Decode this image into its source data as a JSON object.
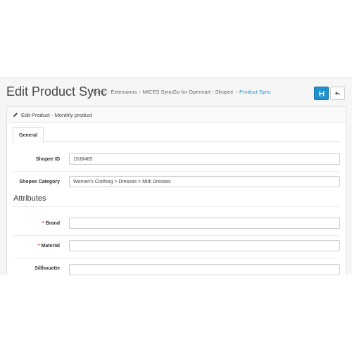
{
  "header": {
    "title": "Edit Product Sync",
    "breadcrumbs": [
      "Home",
      "Extensions",
      "MICES SyncGo for Opencart - Shopee",
      "Product Sync"
    ],
    "separator": "›"
  },
  "panel": {
    "heading": "Edit Product - Monthly product",
    "tabs": [
      {
        "label": "General"
      }
    ]
  },
  "form": {
    "shopee_id": {
      "label": "Shopee ID",
      "value": "1538465"
    },
    "shopee_category": {
      "label": "Shopee Category",
      "value": "Women's Clothing > Dresses > Midi Dresses"
    },
    "attributes_title": "Attributes",
    "brand": {
      "label": "Brand",
      "value": ""
    },
    "material": {
      "label": "Material",
      "value": ""
    },
    "silhouette": {
      "label": "Sillhouette",
      "value": ""
    },
    "required_marker": "*"
  },
  "colors": {
    "primary": "#1e91cf",
    "required": "#e3503e"
  },
  "icons": {
    "save": "save-icon",
    "back": "reply-icon",
    "heading": "pencil-icon"
  }
}
